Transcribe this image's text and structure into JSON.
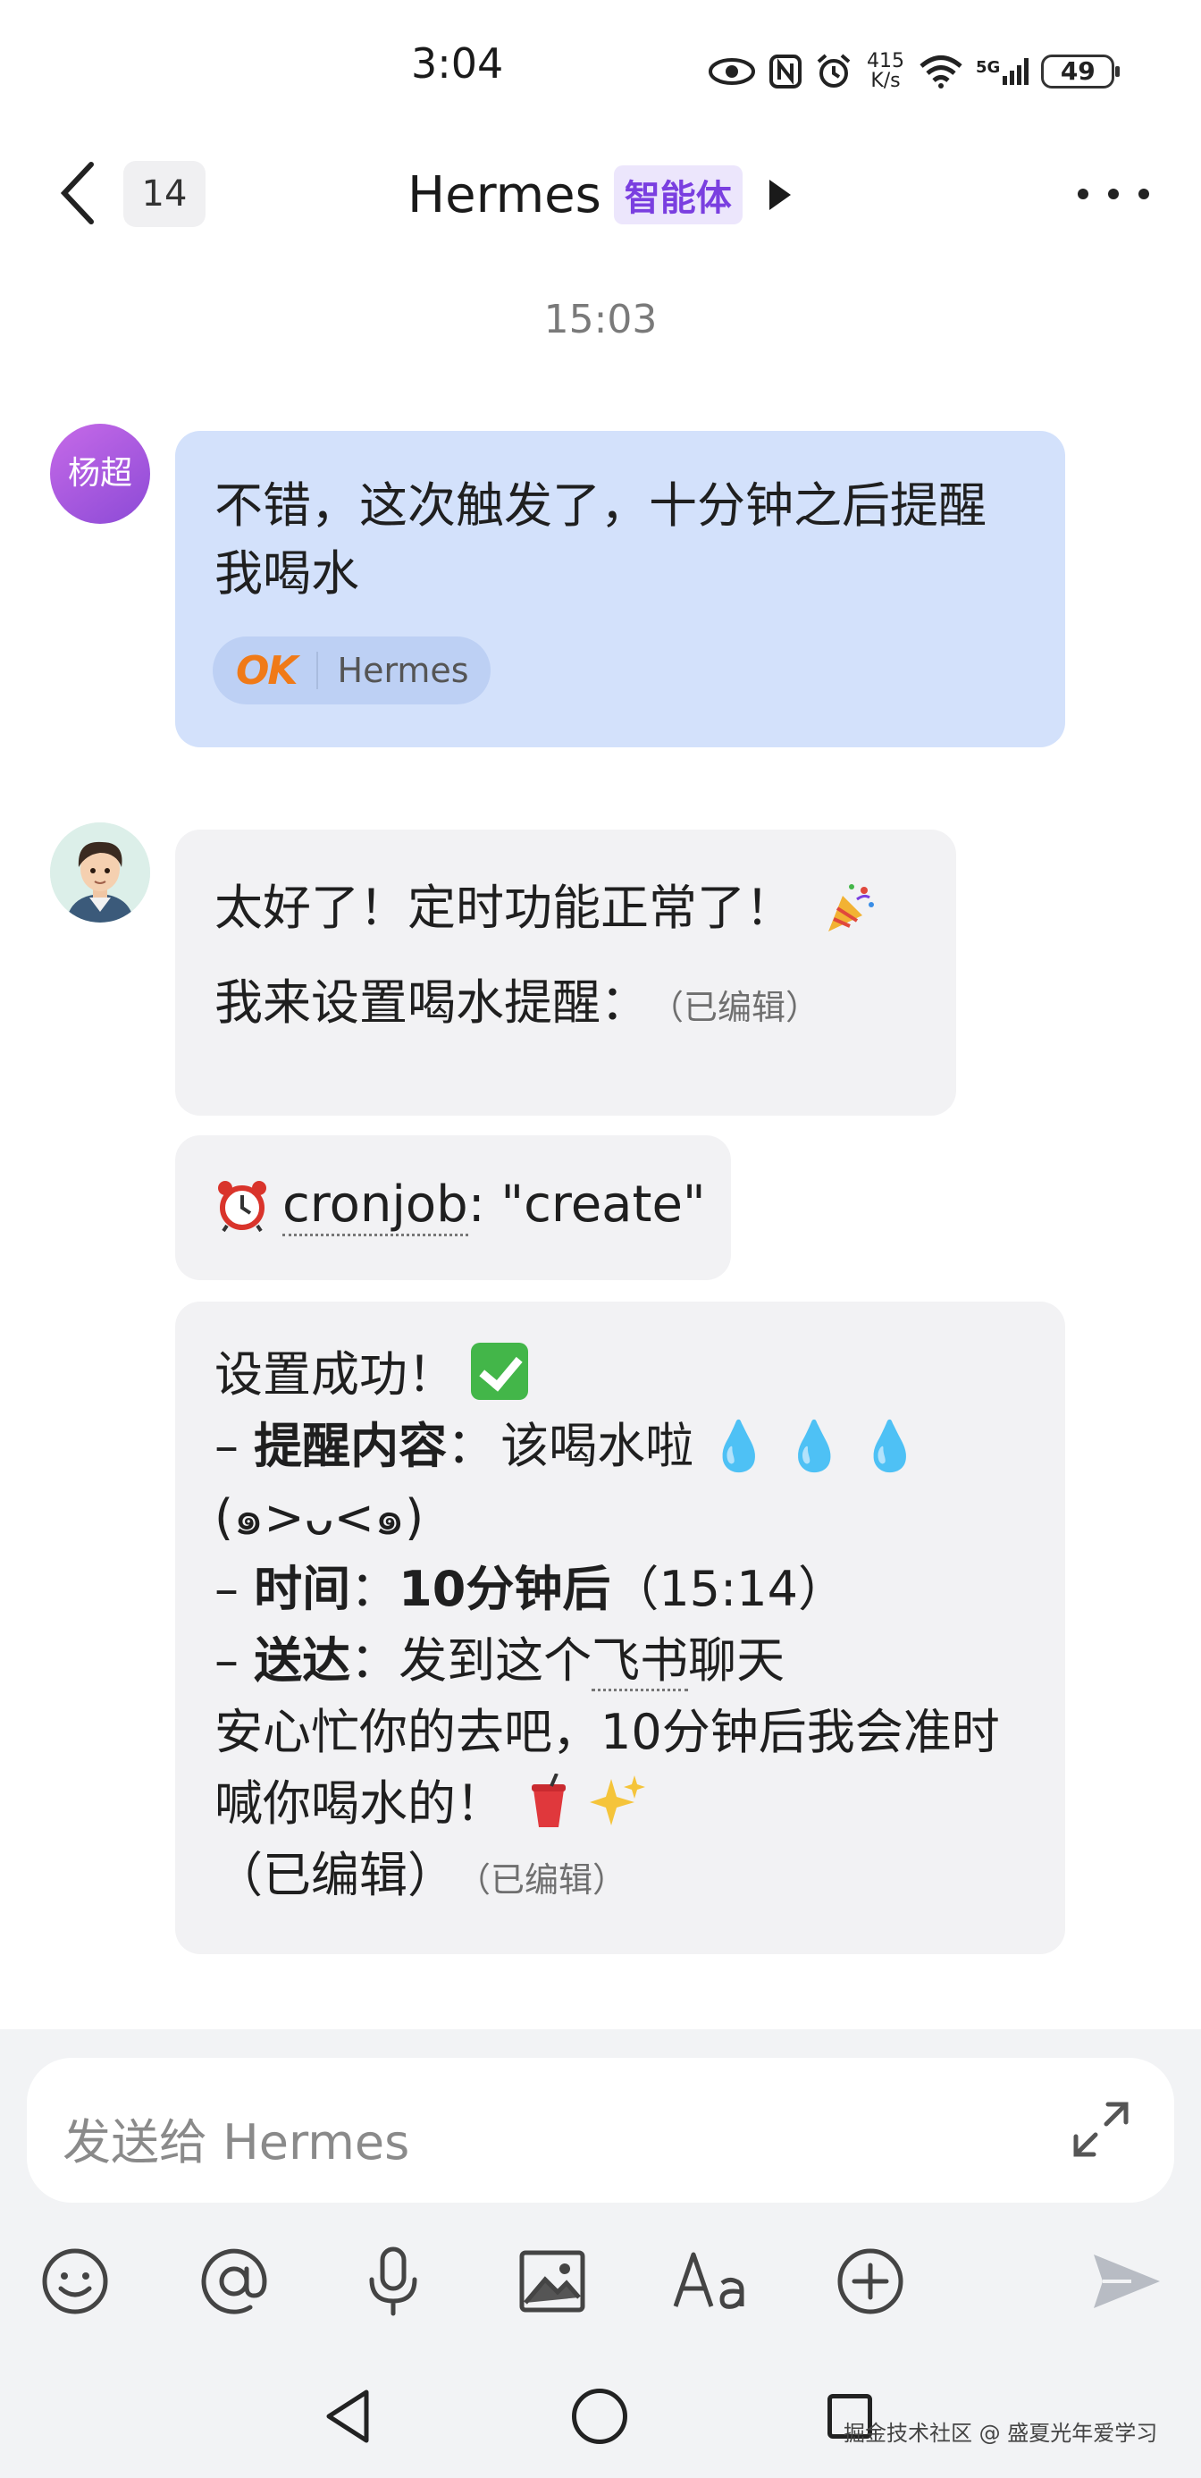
{
  "status_bar": {
    "time": "3:04",
    "net_speed_value": "415",
    "net_speed_unit": "K/s",
    "network": "5G",
    "battery": "49"
  },
  "header": {
    "unread_count": "14",
    "title": "Hermes",
    "badge": "智能体"
  },
  "chat": {
    "timestamp": "15:03",
    "user_avatar_text": "杨超",
    "user_message": "不错，这次触发了，十分钟之后提醒我喝水",
    "reaction_emoji": "OK",
    "reaction_user": "Hermes",
    "bot_msg1_line1": "太好了！定时功能正常了！",
    "bot_msg1_line2": "我来设置喝水提醒：",
    "edited_tag": "（已编辑）",
    "tool_call_name": "cronjob",
    "tool_call_arg": ": \"create\"",
    "result": {
      "title": "设置成功！",
      "item1_label": "提醒内容",
      "item1_value": "该喝水啦",
      "kaomoji": "(๑>ᴗ<๑)",
      "item2_label": "时间",
      "item2_value_bold": "10分钟后",
      "item2_value_time": "（15:14）",
      "item3_label": "送达",
      "item3_value_pre": "发到这个",
      "item3_value_link": "飞书",
      "item3_value_post": "聊天",
      "closing": "安心忙你的去吧，10分钟后我会准时喊你喝水的！",
      "edited_inline": "（已编辑）",
      "edited_tag": "（已编辑）"
    }
  },
  "composer": {
    "placeholder": "发送给 Hermes"
  },
  "watermark": "掘金技术社区 @ 盛夏光年爱学习",
  "icons": [
    "back-icon",
    "play-icon",
    "more-icon",
    "emoji-icon",
    "mention-icon",
    "mic-icon",
    "image-icon",
    "font-icon",
    "add-icon",
    "send-icon",
    "expand-icon"
  ]
}
